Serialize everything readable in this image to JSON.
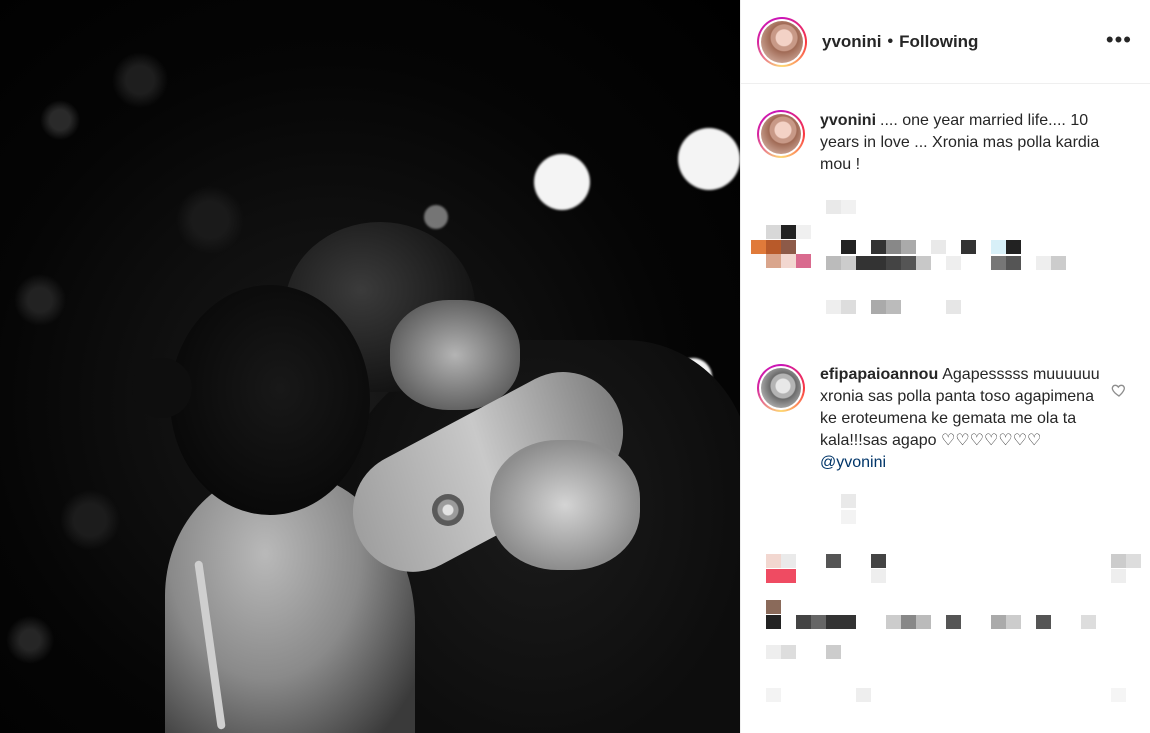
{
  "post": {
    "author": "yvonini",
    "separator": "•",
    "follow_status": "Following",
    "more_label": "•••",
    "caption": {
      "username": "yvonini",
      "text": ".... one year married life.... 10 years in love ... Xronia mas polla kardia mou !"
    },
    "comments": [
      {
        "username": "efipapaioannou",
        "text": "Agapesssss muuuuuu xronia sas polla panta toso agapimena ke eroteumena ke gemata me ola ta kala!!!sas agapo ♡♡♡♡♡♡♡ ",
        "mention": "@yvonini"
      }
    ]
  },
  "icons": {
    "like": "heart-icon",
    "more": "more-options-icon"
  },
  "colors": {
    "story_ring": "#d6249f",
    "mention": "#003569",
    "border": "#efefef"
  }
}
